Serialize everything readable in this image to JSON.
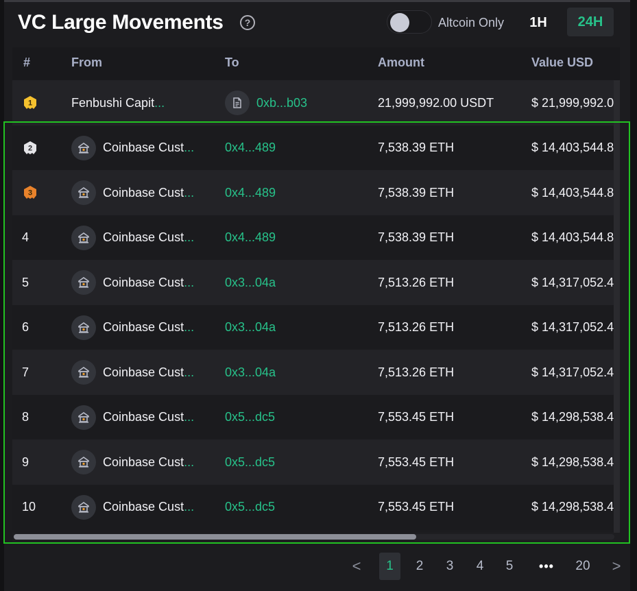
{
  "header": {
    "title": "VC Large Movements",
    "help_icon": "question-circle-icon",
    "altcoin_toggle": {
      "label": "Altcoin Only",
      "on": false
    },
    "timeframes": [
      {
        "label": "1H",
        "active": false
      },
      {
        "label": "24H",
        "active": true
      }
    ]
  },
  "colors": {
    "accent": "#27c28a",
    "gold": "#f5c12e",
    "silver": "#e4e4e8",
    "bronze": "#e8822b",
    "background": "#1c1c1f"
  },
  "table": {
    "columns": [
      "#",
      "From",
      "To",
      "Amount",
      "Value USD"
    ],
    "rows": [
      {
        "rank": "1",
        "medal": "gold",
        "from": "Fenbushi Capit",
        "from_icon": "none",
        "to": "0xb...b03",
        "to_icon": "document-icon",
        "amount": "21,999,992.00 USDT",
        "value": "$ 21,999,992.0"
      },
      {
        "rank": "2",
        "medal": "silver",
        "from": "Coinbase Cust",
        "from_icon": "bank-icon",
        "to": "0x4...489",
        "to_icon": "none",
        "amount": "7,538.39 ETH",
        "value": "$ 14,403,544.8"
      },
      {
        "rank": "3",
        "medal": "bronze",
        "from": "Coinbase Cust",
        "from_icon": "bank-icon",
        "to": "0x4...489",
        "to_icon": "none",
        "amount": "7,538.39 ETH",
        "value": "$ 14,403,544.8"
      },
      {
        "rank": "4",
        "medal": "none",
        "from": "Coinbase Cust",
        "from_icon": "bank-icon",
        "to": "0x4...489",
        "to_icon": "none",
        "amount": "7,538.39 ETH",
        "value": "$ 14,403,544.8"
      },
      {
        "rank": "5",
        "medal": "none",
        "from": "Coinbase Cust",
        "from_icon": "bank-icon",
        "to": "0x3...04a",
        "to_icon": "none",
        "amount": "7,513.26 ETH",
        "value": "$ 14,317,052.4"
      },
      {
        "rank": "6",
        "medal": "none",
        "from": "Coinbase Cust",
        "from_icon": "bank-icon",
        "to": "0x3...04a",
        "to_icon": "none",
        "amount": "7,513.26 ETH",
        "value": "$ 14,317,052.4"
      },
      {
        "rank": "7",
        "medal": "none",
        "from": "Coinbase Cust",
        "from_icon": "bank-icon",
        "to": "0x3...04a",
        "to_icon": "none",
        "amount": "7,513.26 ETH",
        "value": "$ 14,317,052.4"
      },
      {
        "rank": "8",
        "medal": "none",
        "from": "Coinbase Cust",
        "from_icon": "bank-icon",
        "to": "0x5...dc5",
        "to_icon": "none",
        "amount": "7,553.45 ETH",
        "value": "$ 14,298,538.4"
      },
      {
        "rank": "9",
        "medal": "none",
        "from": "Coinbase Cust",
        "from_icon": "bank-icon",
        "to": "0x5...dc5",
        "to_icon": "none",
        "amount": "7,553.45 ETH",
        "value": "$ 14,298,538.4"
      },
      {
        "rank": "10",
        "medal": "none",
        "from": "Coinbase Cust",
        "from_icon": "bank-icon",
        "to": "0x5...dc5",
        "to_icon": "none",
        "amount": "7,553.45 ETH",
        "value": "$ 14,298,538.4"
      }
    ],
    "ellipsis": "...",
    "horizontal_scroll_fraction": 0.67
  },
  "pagination": {
    "prev": "<",
    "pages": [
      "1",
      "2",
      "3",
      "4",
      "5"
    ],
    "dots": "•••",
    "last": "20",
    "next": ">",
    "current": "1"
  }
}
